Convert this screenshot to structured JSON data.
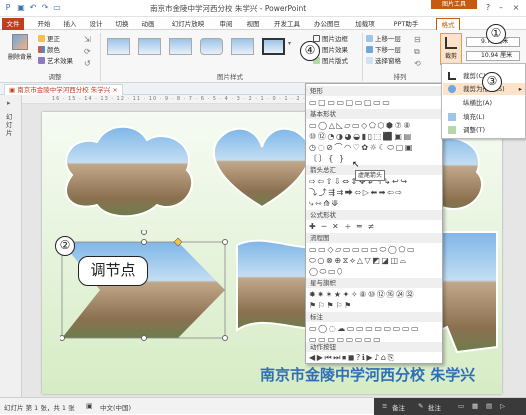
{
  "window": {
    "title": "南京市金陵中学河西分校 朱学兴 - PowerPoint",
    "context_group": "图片工具",
    "quick_access": [
      "save-icon",
      "undo-icon",
      "redo-icon",
      "present-icon"
    ]
  },
  "tabs": [
    "文件",
    "开始",
    "插入",
    "设计",
    "切换",
    "动画",
    "幻灯片放映",
    "审阅",
    "视图",
    "开发工具",
    "办公图巨",
    "加载项",
    "PPT助手",
    "格式"
  ],
  "ribbon": {
    "adjust_group": "调整",
    "remove_bg": "删除背景",
    "adjust_items": [
      "更正",
      "颜色",
      "艺术效果"
    ],
    "picture_styles_group": "图片样式",
    "picture_style_options": [
      "图片边框",
      "图片效果",
      "图片版式"
    ],
    "arrange_group": "排列",
    "arrange_items": [
      "上移一层",
      "下移一层",
      "选择窗格"
    ],
    "crop_label": "裁剪",
    "size_height": "9.73 厘米",
    "size_width": "10.94 厘米"
  },
  "doc_tab": "南京市金陵中学河西分校 朱学兴",
  "left_panel": "幻灯片",
  "ruler_text": "16 · 15 · 14 · 13 · 12 · 11 · 10 · 9 · 8 · 7 · 6 · 5 · 4 · 3 · 2 · 1 · 0 · 1 · 2 · 3 · 4 · 5 · 6 · 7 · 8",
  "context_menu": {
    "items": [
      {
        "label": "裁剪(C)",
        "highlighted": false
      },
      {
        "label": "裁剪为形状(S)",
        "highlighted": true
      },
      {
        "label": "纵横比(A)",
        "highlighted": false
      },
      {
        "label": "填充(L)",
        "highlighted": false
      },
      {
        "label": "调整(T)",
        "highlighted": false
      }
    ]
  },
  "shape_gallery": {
    "categories": [
      "矩形",
      "基本形状",
      "箭头总汇",
      "公式形状",
      "流程图",
      "星与旗帜",
      "标注",
      "动作按钮"
    ],
    "rows": {
      "rect": "▭▢▭▭▢▭▢▭▭",
      "basic1": "▭◯△◺▱▭◇⬠⬡⬢⑦⑧",
      "basic2": "⑩⑫◔◑◕◒▮▯⬚⬛▣▤",
      "basic3": "◷◌⊘⌒◠♡✿☼☾⬭▢▣",
      "basic4": "〔〕{  }",
      "arrows1": "⇨⇦⇧⇩⇔⇕✥↲↰↳↩↪",
      "arrows2": "⤵⤴⇶⇉⮕⬄▷⬅➡⇦⇨",
      "arrows3": "⤷⇿⟰⟱",
      "equation": "✚ ─ ✕ ÷ ═ ≠",
      "flow1": "▭▭◇▱▭▭▭▭⬭◯⬠▭",
      "flow2": "⬭○⊗⊕⧖⟡△▽◩◪◫⌓",
      "flow3": "◯⬭▭⬯",
      "stars1": "✸✷✶★✦✧⑧⑩⑫⑯㉔㉜",
      "stars2": "⚑⚐⚑⚐⚑",
      "callouts1": "▭◯◌☁▭▭▭▭▭▭▭▭",
      "callouts2": "▭▭▭▭▭▭▭▭",
      "actions": "◀▶⏮⏭⏹◼?ℹ▶♪⌂⎘"
    },
    "tooltip": "虚尾箭头"
  },
  "annotations": {
    "circle1": "①",
    "circle2": "②",
    "circle3": "③",
    "circle4": "④",
    "callout": "调节点"
  },
  "slide_footer_text": "南京市金陵中学河西分校 朱学兴",
  "status": {
    "slide_info": "幻灯片 第 1 张，共 1 张",
    "language": "中文(中国)",
    "notes": "备注",
    "comments": "批注"
  },
  "colors": {
    "file_tab": "#c43e1c",
    "context_accent": "#c55a11",
    "footer_text": "#2f6fb5"
  }
}
